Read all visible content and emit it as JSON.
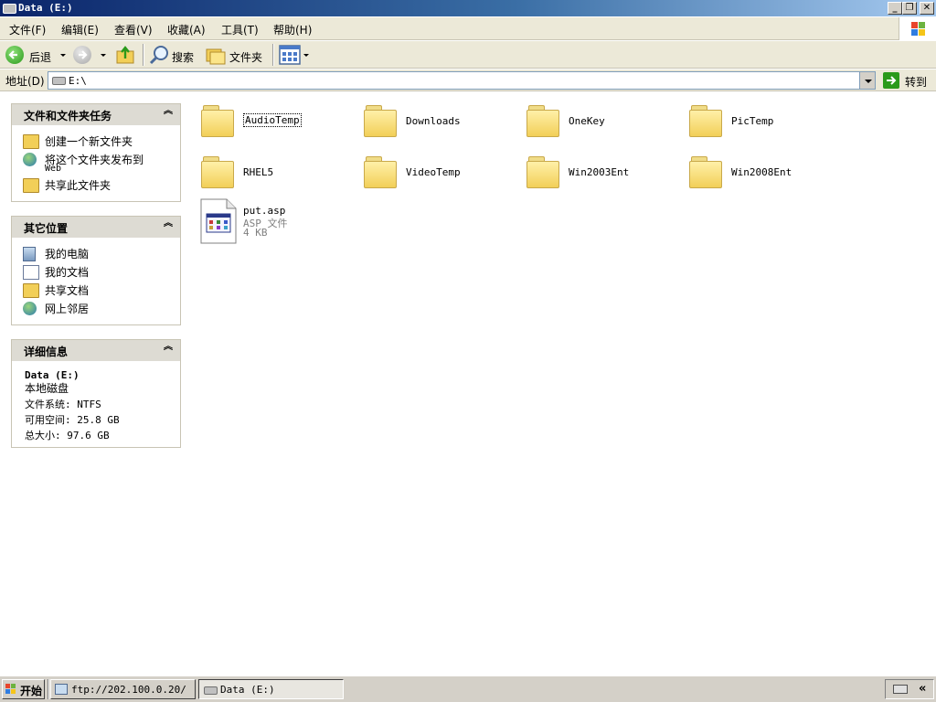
{
  "window": {
    "title": "Data (E:)"
  },
  "menu": [
    {
      "label": "文件(F)"
    },
    {
      "label": "编辑(E)"
    },
    {
      "label": "查看(V)"
    },
    {
      "label": "收藏(A)"
    },
    {
      "label": "工具(T)"
    },
    {
      "label": "帮助(H)"
    }
  ],
  "toolbar": {
    "back_label": "后退",
    "search_label": "搜索",
    "folders_label": "文件夹"
  },
  "address": {
    "label": "地址(D)",
    "value": "E:\\",
    "go_label": "转到"
  },
  "tasks": {
    "file_tasks": {
      "title": "文件和文件夹任务",
      "items": [
        {
          "label": "创建一个新文件夹"
        },
        {
          "label": "将这个文件夹发布到",
          "sub": "Web"
        },
        {
          "label": "共享此文件夹"
        }
      ]
    },
    "other_places": {
      "title": "其它位置",
      "items": [
        {
          "label": "我的电脑"
        },
        {
          "label": "我的文档"
        },
        {
          "label": "共享文档"
        },
        {
          "label": "网上邻居"
        }
      ]
    },
    "details": {
      "title": "详细信息",
      "name": "Data (E:)",
      "type": "本地磁盘",
      "filesystem": "文件系统: NTFS",
      "free": "可用空间: 25.8 GB",
      "total": "总大小: 97.6 GB"
    }
  },
  "files": [
    {
      "name": "AudioTemp"
    },
    {
      "name": "Downloads"
    },
    {
      "name": "OneKey"
    },
    {
      "name": "PicTemp"
    },
    {
      "name": "RHEL5"
    },
    {
      "name": "VideoTemp"
    },
    {
      "name": "Win2003Ent"
    },
    {
      "name": "Win2008Ent"
    }
  ],
  "file_item": {
    "name": "put.asp",
    "type": "ASP 文件",
    "size": "4 KB"
  },
  "taskbar": {
    "start_label": "开始",
    "tasks": [
      {
        "label": "ftp://202.100.0.20/"
      },
      {
        "label": "Data (E:)"
      }
    ],
    "tray_chevron": "«"
  },
  "colors": {
    "titlebar": "#0a246a",
    "panel_header": "#dddbd3",
    "folder": "#f2cf58",
    "taskbar": "#d4d0c8"
  }
}
